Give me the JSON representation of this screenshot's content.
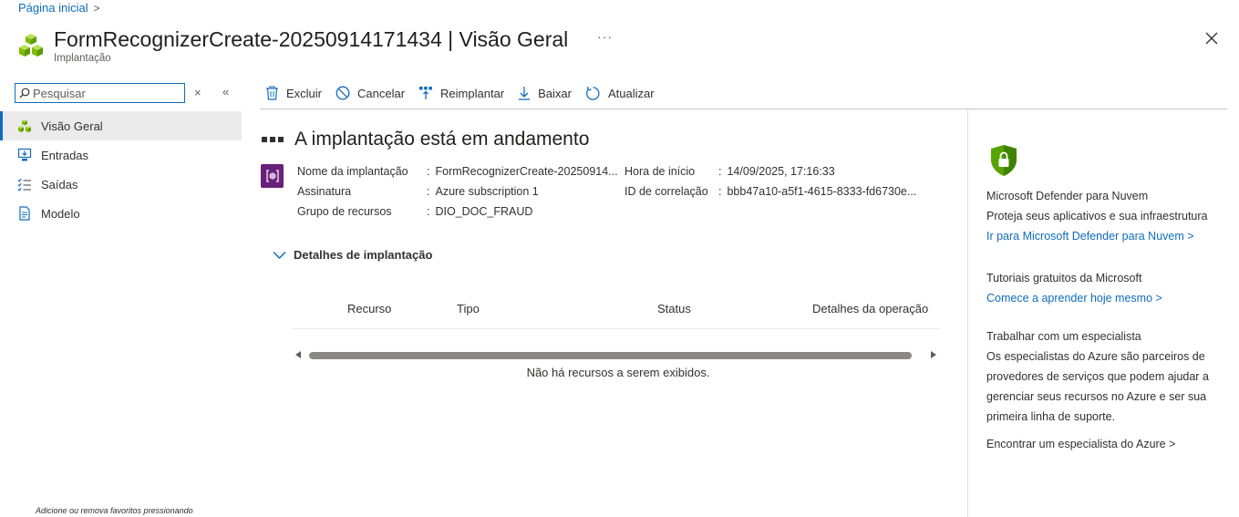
{
  "breadcrumb": {
    "home_label": "Página inicial",
    "chevron": ">"
  },
  "header": {
    "title": "FormRecognizerCreate-20250914171434 | Visão Geral",
    "subtitle": "Implantação",
    "more": "···",
    "close_icon": "close-icon"
  },
  "nav": {
    "search_placeholder": "Pesquisar",
    "clear": "×",
    "collapse": "«",
    "items": [
      {
        "label": "Visão Geral",
        "icon": "overview-cubes-icon",
        "active": true
      },
      {
        "label": "Entradas",
        "icon": "inputs-icon",
        "active": false
      },
      {
        "label": "Saídas",
        "icon": "outputs-list-icon",
        "active": false
      },
      {
        "label": "Modelo",
        "icon": "template-document-icon",
        "active": false
      }
    ],
    "footer_hint": "Adicione ou remova favoritos pressionando"
  },
  "toolbar": {
    "delete": "Excluir",
    "cancel": "Cancelar",
    "redeploy": "Reimplantar",
    "download": "Baixar",
    "refresh": "Atualizar"
  },
  "deployment": {
    "status_title": "A implantação está em andamento",
    "name_label": "Nome da implantação",
    "name_value": "FormRecognizerCreate-20250914...",
    "subscription_label": "Assinatura",
    "subscription_value": "Azure subscription 1",
    "resource_group_label": "Grupo de recursos",
    "resource_group_value": "DIO_DOC_FRAUD",
    "start_time_label": "Hora de início",
    "start_time_value": "14/09/2025, 17:16:33",
    "correlation_label": "ID de correlação",
    "correlation_value": "bbb47a10-a5f1-4615-8333-fd6730e...",
    "separator": ":"
  },
  "details": {
    "toggle_label": "Detalhes de implantação",
    "columns": [
      "Recurso",
      "Tipo",
      "Status",
      "Detalhes da operação"
    ],
    "empty_message": "Não há recursos a serem exibidos."
  },
  "right_panel": {
    "defender_title": "Microsoft Defender para Nuvem",
    "defender_desc": "Proteja seus aplicativos e sua infraestrutura",
    "defender_link": "Ir para Microsoft Defender para Nuvem >",
    "tutorials_title": "Tutoriais gratuitos da Microsoft",
    "tutorials_link": "Comece a aprender hoje mesmo >",
    "expert_title": "Trabalhar com um especialista",
    "expert_desc_1": "Os especialistas do Azure são parceiros de",
    "expert_desc_2": "provedores de serviços que podem ajudar a",
    "expert_desc_3": "gerenciar seus recursos no Azure e ser sua",
    "expert_desc_4": "primeira linha de suporte.",
    "expert_link": "Encontrar um especialista do Azure >"
  },
  "colors": {
    "accent": "#0f6cbd",
    "deployment_icon_bg": "#68217a",
    "shield_green": "#57a300",
    "cube_green": "#7fba00"
  }
}
